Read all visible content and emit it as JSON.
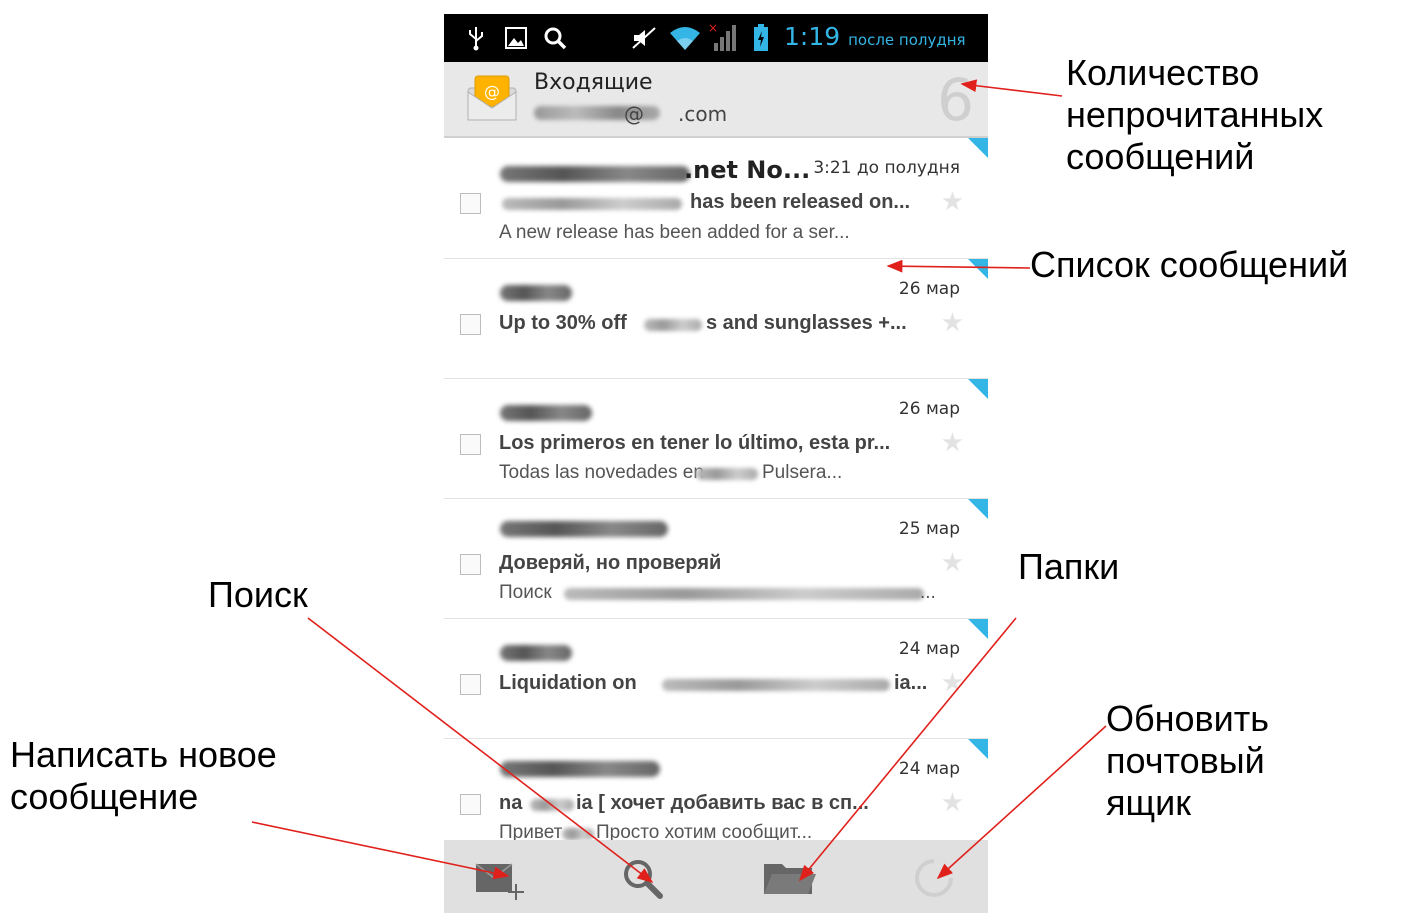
{
  "status_bar": {
    "time": "1:19",
    "period": "после полудня",
    "icons": [
      "usb-icon",
      "image-icon",
      "search-icon",
      "mute-icon",
      "wifi-icon",
      "signal-icon",
      "battery-icon"
    ]
  },
  "header": {
    "title": "Входящие",
    "account_at": "@",
    "account_domain": ".com",
    "unread_count": "6",
    "icon": "mail-envelope-icon"
  },
  "messages": [
    {
      "sender": ".net No...",
      "date": "3:21 до полудня",
      "subject": "has been released on...",
      "preview": "A new release has been added for a ser...",
      "starred": false,
      "unread": true
    },
    {
      "sender": "",
      "date": "26 мар",
      "subject_prefix": "Up to 30% off",
      "subject": "s and sunglasses +...",
      "preview": "",
      "starred": false,
      "unread": true
    },
    {
      "sender": "",
      "date": "26 мар",
      "subject": "Los primeros en tener lo último, esta pr...",
      "preview_prefix": "Todas las novedades en",
      "preview": "Pulsera...",
      "starred": false,
      "unread": true
    },
    {
      "sender": "",
      "date": "25 мар",
      "subject": "Доверяй, но проверяй",
      "preview_prefix": "Поиск",
      "preview": "...",
      "starred": false,
      "unread": true
    },
    {
      "sender": "",
      "date": "24 мар",
      "subject_prefix": "Liquidation on",
      "subject": "ia...",
      "preview": "",
      "starred": false,
      "unread": true
    },
    {
      "sender": "",
      "date": "24 мар",
      "subject_prefix": "na",
      "subject": "ia [ хочет добавить вас в сп...",
      "preview_prefix": "Привет",
      "preview": "Просто хотим сообщит...",
      "starred": false,
      "unread": true
    }
  ],
  "bottom_bar": {
    "compose": "compose-icon",
    "search": "search-icon",
    "folders": "folder-icon",
    "refresh": "refresh-icon"
  },
  "annotations": {
    "unread_count_1": "Количество",
    "unread_count_2": "непрочитанных",
    "unread_count_3": "сообщений",
    "message_list": "Список сообщений",
    "folders": "Папки",
    "search": "Поиск",
    "compose_1": "Написать новое",
    "compose_2": "сообщение",
    "refresh_1": "Обновить",
    "refresh_2": "почтовый",
    "refresh_3": "ящик"
  },
  "colors": {
    "accent": "#33b5e5",
    "arrow": "#e0201b",
    "status_bar": "#000000",
    "header": "#e8e8e8"
  }
}
